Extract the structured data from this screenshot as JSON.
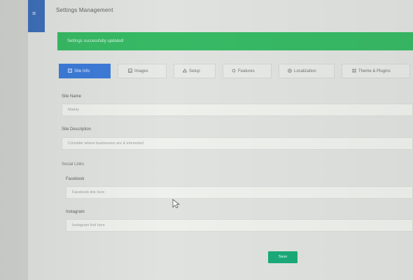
{
  "header": {
    "title": "Settings Management"
  },
  "alert": {
    "message": "Settings successfully updated!"
  },
  "tabs": [
    {
      "label": "Site Info",
      "icon": "site-info-icon",
      "active": true
    },
    {
      "label": "Images",
      "icon": "image-icon",
      "active": false
    },
    {
      "label": "Setup",
      "icon": "setup-icon",
      "active": false
    },
    {
      "label": "Features",
      "icon": "features-icon",
      "active": false
    },
    {
      "label": "Localization",
      "icon": "globe-icon",
      "active": false
    },
    {
      "label": "Theme & Plugins",
      "icon": "theme-icon",
      "active": false
    }
  ],
  "form": {
    "site_name_label": "Site Name",
    "site_name_value": "Mainly",
    "site_description_label": "Site Description",
    "site_description_value": "Consider where businesses are & interested",
    "social_links_label": "Social Links",
    "facebook_label": "Facebook",
    "facebook_placeholder": "Facebook link here",
    "instagram_label": "Instagram",
    "instagram_placeholder": "Instagram link here",
    "save_label": "Save"
  },
  "colors": {
    "alert": "#37b964",
    "active_tab": "#3d7bd8",
    "save": "#1aaa7a",
    "sidebar": "#3f6fb8"
  }
}
